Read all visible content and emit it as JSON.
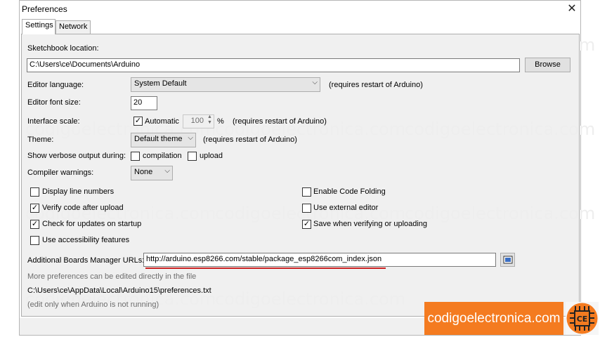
{
  "window": {
    "title": "Preferences"
  },
  "tabs": [
    {
      "label": "Settings"
    },
    {
      "label": "Network"
    }
  ],
  "sketchbook": {
    "label": "Sketchbook location:",
    "value": "C:\\Users\\ce\\Documents\\Arduino",
    "browse_label": "Browse"
  },
  "editor_language": {
    "label": "Editor language:",
    "value": "System Default",
    "note": "(requires restart of Arduino)"
  },
  "font_size": {
    "label": "Editor font size:",
    "value": "20"
  },
  "interface_scale": {
    "label": "Interface scale:",
    "automatic_label": "Automatic",
    "automatic_checked": true,
    "value": "100",
    "unit": "%",
    "note": "(requires restart of Arduino)"
  },
  "theme": {
    "label": "Theme:",
    "value": "Default theme",
    "note": "(requires restart of Arduino)"
  },
  "verbose": {
    "label": "Show verbose output during:",
    "compilation_label": "compilation",
    "upload_label": "upload"
  },
  "warnings": {
    "label": "Compiler warnings:",
    "value": "None"
  },
  "options_left": [
    {
      "label": "Display line numbers",
      "checked": false
    },
    {
      "label": "Verify code after upload",
      "checked": true
    },
    {
      "label": "Check for updates on startup",
      "checked": true
    },
    {
      "label": "Use accessibility features",
      "checked": false
    }
  ],
  "options_right": [
    {
      "label": "Enable Code Folding",
      "checked": false
    },
    {
      "label": "Use external editor",
      "checked": false
    },
    {
      "label": "Save when verifying or uploading",
      "checked": true
    }
  ],
  "boards_urls": {
    "label": "Additional Boards Manager URLs:",
    "value": "http://arduino.esp8266.com/stable/package_esp8266com_index.json"
  },
  "more_prefs": {
    "text": "More preferences can be edited directly in the file"
  },
  "prefs_path": {
    "text": "C:\\Users\\ce\\AppData\\Local\\Arduino15\\preferences.txt"
  },
  "edit_note": {
    "text": "(edit only when Arduino is not running)"
  },
  "watermark": {
    "text": "codigoelectronica.com"
  },
  "brand": {
    "text": "codigoelectronica.com",
    "logo_text": "CE"
  },
  "colors": {
    "brand": "#f47b20",
    "underline": "#cc2222"
  },
  "icons": {
    "close": "close-icon",
    "check": "check-icon",
    "chevron": "chevron-down-icon",
    "url-editor": "url-editor-icon"
  }
}
